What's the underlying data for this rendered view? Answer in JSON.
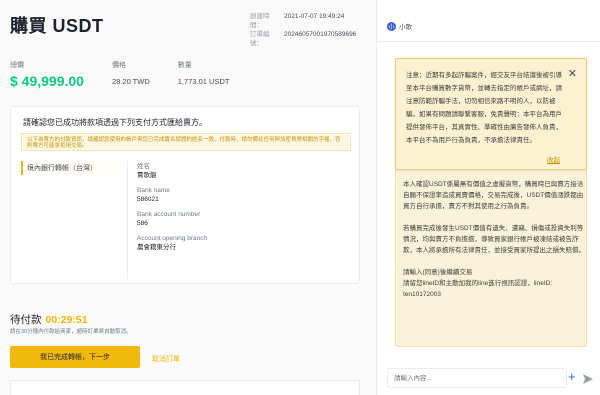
{
  "order": {
    "title": "購買 USDT",
    "created_label": "創建時間：",
    "created_value": "2021-07-07 19:49:24",
    "number_label": "訂單編號：",
    "number_value": "20246057001970589696"
  },
  "summary": {
    "total_label": "總價",
    "total_value": "$ 49,999.00",
    "price_label": "價格",
    "price_value": "28.20 TWD",
    "qty_label": "數量",
    "qty_value": "1,773.01 USDT"
  },
  "payment": {
    "instruction": "請確認您已成功將款項透過下列支付方式匯給賣方。",
    "warning": "以下為賣方的付款資訊，請確認您使用的帳戶與您已完成實名認證的姓名一致。付款時，請勿備註任何與加密貨幣相關的字樣，否則賣方可能會拒絕交易。",
    "method": "境內銀行轉帳（台灣）",
    "fields": [
      {
        "label": "姓名",
        "value": "賈歌龍"
      },
      {
        "label": "Bank name",
        "value": "586021"
      },
      {
        "label": "Bank account number",
        "value": "586"
      },
      {
        "label": "Account opening branch",
        "value": "農會藉東分行"
      }
    ]
  },
  "pending": {
    "label": "待付款",
    "timer": "00:29:51",
    "note": "請在30分鐘內付款給商家，超時訂單將自動取消。"
  },
  "actions": {
    "confirm": "我已完成轉帳，下一步",
    "cancel": "取消訂單"
  },
  "chat": {
    "avatar_letter": "小",
    "contact_name": "小歌",
    "notice": "注意：近期有多起詐騙案件，經交友平台結識後被引導至本平台購買數字貨幣，並轉去指定的帳戶或網址，請注意防範詐騙手法，切勿相信來路不明的人，以防被騙，如果有問題請聯繫客服，免責聲明：本平台為用戶提供發佈平台，其真實性、準確性由廣告發佈人負責，本平台不為用戶行為負責，不承擔法律責任。",
    "collapse": "收起",
    "disclaimer": "本人確認USDT係屬無有價值之虛擬貨幣，購買時已與賣方接洽自願不保證率造成買賣價格，交易完成後，USDT價值漲跌都由買方自行承擔，賣方不對其使用之行為負責。",
    "risk": "若購買完成後發生USDT價值有遺失、遭竊、損傷或投資失利等情況，均與賣方不負擔擔，導致買家銀行帳戶被凍結或被告詐欺，本人將承擔所有法律責任，並接受買家所提出之損失賠償。",
    "reply_prompt": "請輸入(同意)後繼續交易",
    "reply_line": "請留您lineID和主動加我的line進行視訊認證，lineID: ten10172003",
    "input_placeholder": "請輸入內容..."
  }
}
